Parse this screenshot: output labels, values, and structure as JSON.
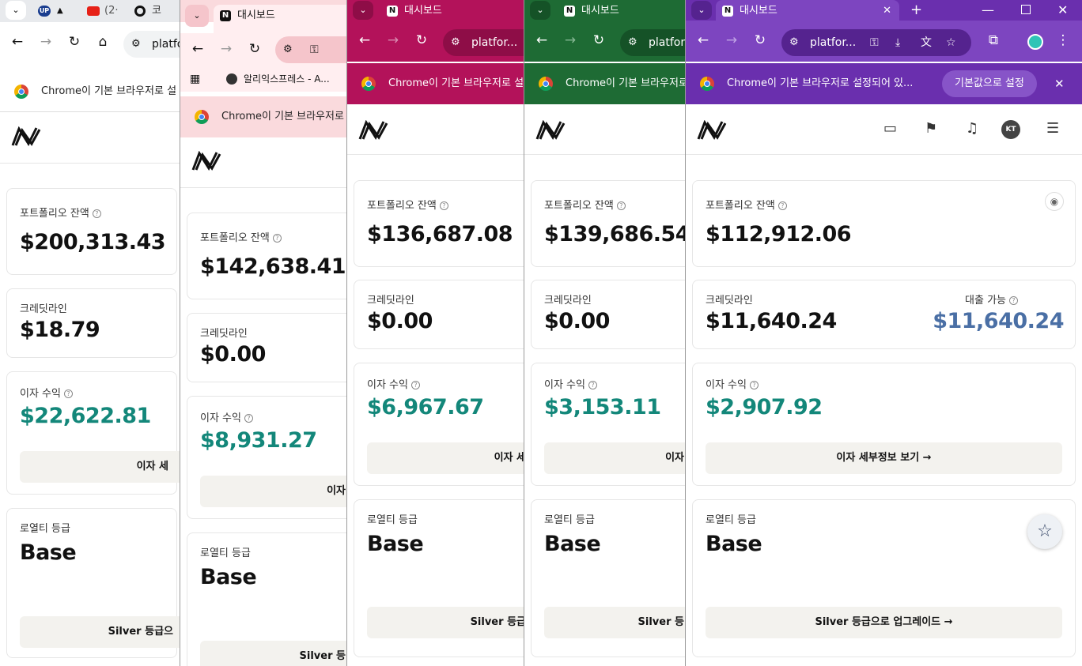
{
  "app_icon_label": "대시보드",
  "windows": [
    {
      "frame_color": "#ffffff",
      "tabs": [
        "",
        "",
        "(2·",
        "코"
      ],
      "url": "platfo",
      "infobar_text": "Chrome이 기본 브라우저로 설",
      "portfolio_label": "포트폴리오 잔액",
      "portfolio_value": "$200,313.43",
      "credit_label": "크레딧라인",
      "credit_value": "$18.79",
      "interest_label": "이자 수익",
      "interest_value": "$22,622.81",
      "interest_btn": "이자 세",
      "loyalty_label": "로열티 등급",
      "loyalty_value": "Base",
      "upgrade_btn": "Silver 등급으"
    },
    {
      "frame_color": "#fadadd",
      "tab_title": "대시보드",
      "url": "",
      "bookmark": "알리익스프레스 - A...",
      "infobar_text": "Chrome이 기본 브라우저로",
      "portfolio_label": "포트폴리오 잔액",
      "portfolio_value": "$142,638.41",
      "credit_label": "크레딧라인",
      "credit_value": "$0.00",
      "interest_label": "이자 수익",
      "interest_value": "$8,931.27",
      "interest_btn": "이자",
      "loyalty_label": "로열티 등급",
      "loyalty_value": "Base",
      "upgrade_btn": "Silver 등"
    },
    {
      "frame_color": "#b3125a",
      "tab_title": "대시보드",
      "url": "platfor...",
      "infobar_text": "Chrome이 기본 브라우저로 설",
      "portfolio_label": "포트폴리오 잔액",
      "portfolio_value": "$136,687.08",
      "credit_label": "크레딧라인",
      "credit_value": "$0.00",
      "interest_label": "이자 수익",
      "interest_value": "$6,967.67",
      "interest_btn": "이자 세",
      "loyalty_label": "로열티 등급",
      "loyalty_value": "Base",
      "upgrade_btn": "Silver 등급"
    },
    {
      "frame_color": "#1e6b34",
      "tab_title": "대시보드",
      "url": "platfor...",
      "infobar_text": "Chrome이 기본 브라우저로 설",
      "portfolio_label": "포트폴리오 잔액",
      "portfolio_value": "$139,686.54",
      "credit_label": "크레딧라인",
      "credit_value": "$0.00",
      "interest_label": "이자 수익",
      "interest_value": "$3,153.11",
      "interest_btn": "이자",
      "loyalty_label": "로열티 등급",
      "loyalty_value": "Base",
      "upgrade_btn": "Silver 등"
    },
    {
      "frame_color": "#6a2fae",
      "tab_title": "대시보드",
      "url": "platfor...",
      "infobar_text": "Chrome이 기본 브라우저로 설정되어 있...",
      "infobar_btn": "기본값으로 설정",
      "avatar": "KT",
      "portfolio_label": "포트폴리오 잔액",
      "portfolio_value": "$112,912.06",
      "credit_label": "크레딧라인",
      "credit_value": "$11,640.24",
      "loan_label": "대출 가능",
      "loan_value": "$11,640.24",
      "interest_label": "이자 수익",
      "interest_value": "$2,907.92",
      "interest_btn": "이자 세부정보 보기 →",
      "loyalty_label": "로열티 등급",
      "loyalty_value": "Base",
      "upgrade_btn": "Silver 등급으로 업그레이드 →"
    }
  ]
}
